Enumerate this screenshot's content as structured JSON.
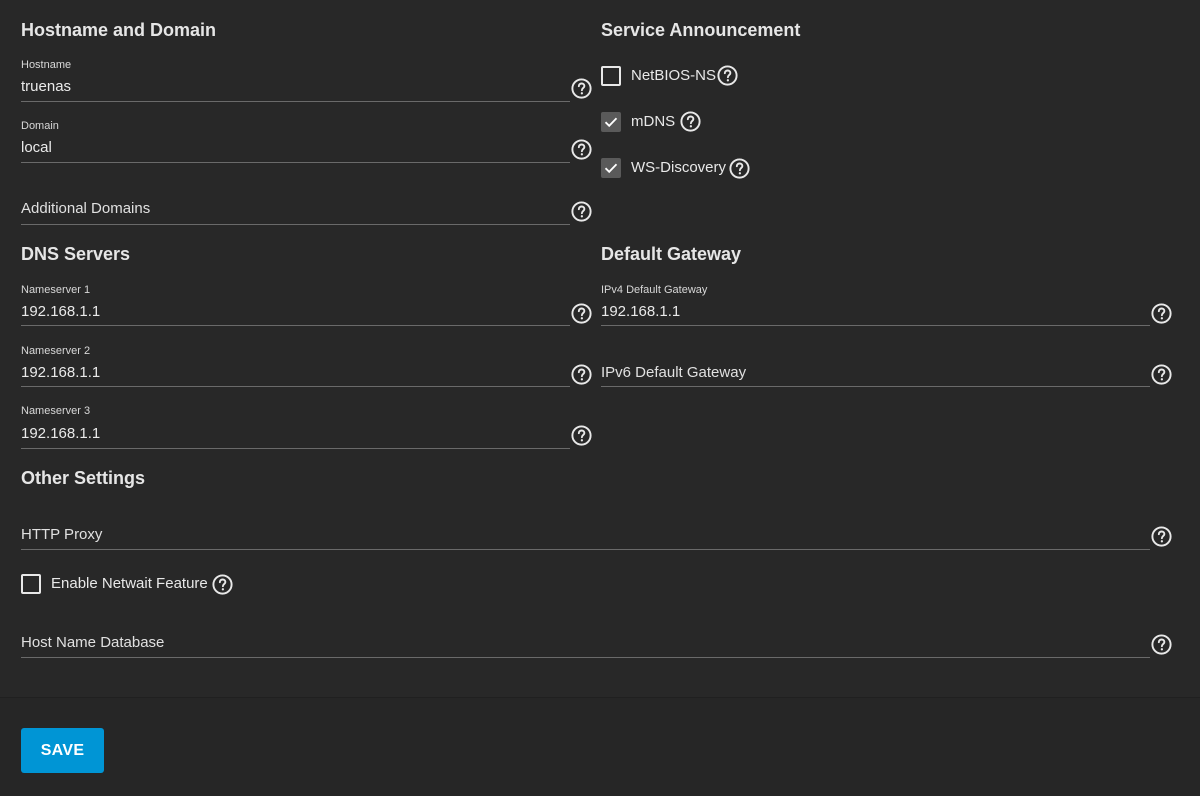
{
  "sections": {
    "hostname_domain": "Hostname and Domain",
    "service_announcement": "Service Announcement",
    "dns_servers": "DNS Servers",
    "default_gateway": "Default Gateway",
    "other_settings": "Other Settings"
  },
  "fields": {
    "hostname": {
      "label": "Hostname",
      "value": "truenas"
    },
    "domain": {
      "label": "Domain",
      "value": "local"
    },
    "additional_domains": {
      "placeholder": "Additional Domains"
    },
    "nameserver1": {
      "label": "Nameserver 1",
      "value": "192.168.1.1"
    },
    "nameserver2": {
      "label": "Nameserver 2",
      "value": "192.168.1.1"
    },
    "nameserver3": {
      "label": "Nameserver 3",
      "value": "192.168.1.1"
    },
    "ipv4_gateway": {
      "label": "IPv4 Default Gateway",
      "value": "192.168.1.1"
    },
    "ipv6_gateway": {
      "placeholder": "IPv6 Default Gateway"
    },
    "http_proxy": {
      "placeholder": "HTTP Proxy"
    },
    "host_name_database": {
      "placeholder": "Host Name Database"
    }
  },
  "checkboxes": {
    "netbios_ns": {
      "label": "NetBIOS-NS",
      "checked": false
    },
    "mdns": {
      "label": "mDNS",
      "checked": true
    },
    "ws_discovery": {
      "label": "WS-Discovery",
      "checked": true
    },
    "netwait": {
      "label": "Enable Netwait Feature",
      "checked": false
    }
  },
  "icons": {
    "help": "help-circle-icon",
    "check": "check-icon"
  },
  "colors": {
    "background": "#282828",
    "accent": "#0095d5",
    "text": "#e8e8e8",
    "underline": "#6a6a6a"
  },
  "footer": {
    "save_label": "SAVE"
  }
}
